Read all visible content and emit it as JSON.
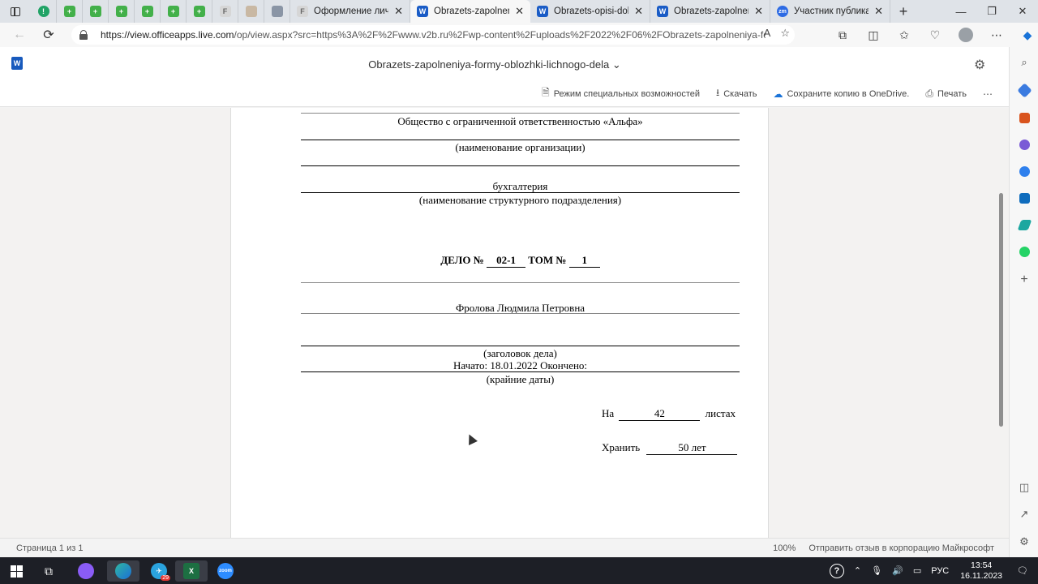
{
  "browser": {
    "pinned_tabs": [
      {
        "icon": "green-circle-icon",
        "glyph": "!"
      },
      {
        "icon": "sheet-plus-icon",
        "glyph": "+"
      },
      {
        "icon": "sheet-plus-icon",
        "glyph": "+"
      },
      {
        "icon": "sheet-plus-icon",
        "glyph": "+"
      },
      {
        "icon": "sheet-plus-icon",
        "glyph": "+"
      },
      {
        "icon": "sheet-plus-icon",
        "glyph": "+"
      },
      {
        "icon": "sheet-plus-icon",
        "glyph": "+"
      },
      {
        "icon": "f-icon",
        "glyph": "F"
      },
      {
        "icon": "image-icon",
        "glyph": ""
      },
      {
        "icon": "document-icon",
        "glyph": ""
      }
    ],
    "tabs": [
      {
        "title": "Оформление личны",
        "icon": "f-icon",
        "glyph": "F",
        "active": false
      },
      {
        "title": "Obrazets-zapolneniy",
        "icon": "word-icon",
        "glyph": "W",
        "active": true
      },
      {
        "title": "Obrazets-opisi-doku",
        "icon": "word-icon",
        "glyph": "W",
        "active": false
      },
      {
        "title": "Obrazets-zapolneniy",
        "icon": "word-icon",
        "glyph": "W",
        "active": false
      },
      {
        "title": "Участник публикаци",
        "icon": "zm-icon",
        "glyph": "zm",
        "active": false
      }
    ],
    "url_host": "https://view.officeapps.live.com",
    "url_path": "/op/view.aspx?src=https%3A%2F%2Fwww.v2b.ru%2Fwp-content%2Fuploads%2F2022%2F06%2FObrazets-zapolneniya-formy..."
  },
  "word": {
    "doc_title": "Obrazets-zapolneniya-formy-oblozhki-lichnogo-dela",
    "commands": {
      "accessibility": "Режим специальных возможностей",
      "download": "Скачать",
      "save_onedrive": "Сохраните копию в OneDrive.",
      "print": "Печать"
    }
  },
  "document": {
    "org_name": "Общество с ограниченной ответственностью «Альфа»",
    "org_caption": "(наименование организации)",
    "department": "бухгалтерия",
    "department_caption": "(наименование структурного подразделения)",
    "case_label": "ДЕЛО №",
    "case_number": "02-1",
    "volume_label": "ТОМ №",
    "volume_number": "1",
    "person_name": "Фролова Людмила Петровна",
    "title_caption": "(заголовок дела)",
    "dates_line": "Начато: 18.01.2022 Окончено:",
    "dates_caption": "(крайние даты)",
    "sheets_prefix": "На",
    "sheets_value": "42",
    "sheets_suffix": "листах",
    "keep_prefix": "Хранить",
    "keep_value": "50 лет"
  },
  "status": {
    "page_info": "Страница 1 из 1",
    "zoom": "100%",
    "feedback": "Отправить отзыв в корпорацию Майкрософт"
  },
  "taskbar": {
    "telegram_badge": "29",
    "zoom_label": "zoom",
    "lang": "РУС",
    "time": "13:54",
    "date": "16.11.2023"
  },
  "colors": {
    "word_blue": "#185abd",
    "tab_strip": "#dfe3e8",
    "taskbar": "#1d1f26"
  }
}
